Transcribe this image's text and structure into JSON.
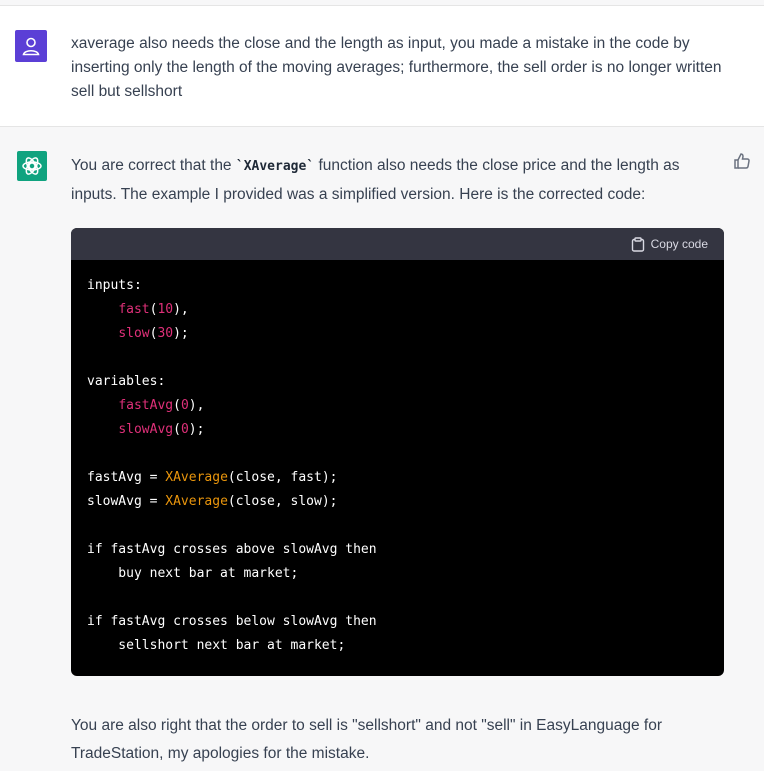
{
  "user_message": {
    "text": "xaverage also needs the close and the length as input, you made a mistake in the code by inserting only the length of the moving averages; furthermore, the sell order is no longer written sell but sellshort"
  },
  "assistant_message": {
    "intro_before": "You are correct that the ",
    "intro_code": "`XAverage`",
    "intro_after": " function also needs the close price and the length as inputs. The example I provided was a simplified version. Here is the corrected code:",
    "copy_label": "Copy code",
    "code": {
      "l1": "inputs:",
      "l2a": "    ",
      "l2fn": "fast",
      "l2p1": "(",
      "l2num": "10",
      "l2p2": "),",
      "l3a": "    ",
      "l3fn": "slow",
      "l3p1": "(",
      "l3num": "30",
      "l3p2": ");",
      "l5": "variables:",
      "l6a": "    ",
      "l6fn": "fastAvg",
      "l6p1": "(",
      "l6num": "0",
      "l6p2": "),",
      "l7a": "    ",
      "l7fn": "slowAvg",
      "l7p1": "(",
      "l7num": "0",
      "l7p2": ");",
      "l9a": "fastAvg = ",
      "l9fn": "XAverage",
      "l9b": "(close, fast);",
      "l10a": "slowAvg = ",
      "l10fn": "XAverage",
      "l10b": "(close, slow);",
      "l12": "if fastAvg crosses above slowAvg then",
      "l13": "    buy next bar at market;",
      "l15": "if fastAvg crosses below slowAvg then",
      "l16": "    sellshort next bar at market;"
    },
    "outro": "You are also right that the order to sell is \"sellshort\" and not \"sell\" in EasyLanguage for TradeStation, my apologies for the mistake."
  },
  "colors": {
    "user_avatar": "#5b3fd6",
    "bot_avatar": "#10a37f",
    "code_bg": "#000000",
    "code_header": "#343541"
  }
}
